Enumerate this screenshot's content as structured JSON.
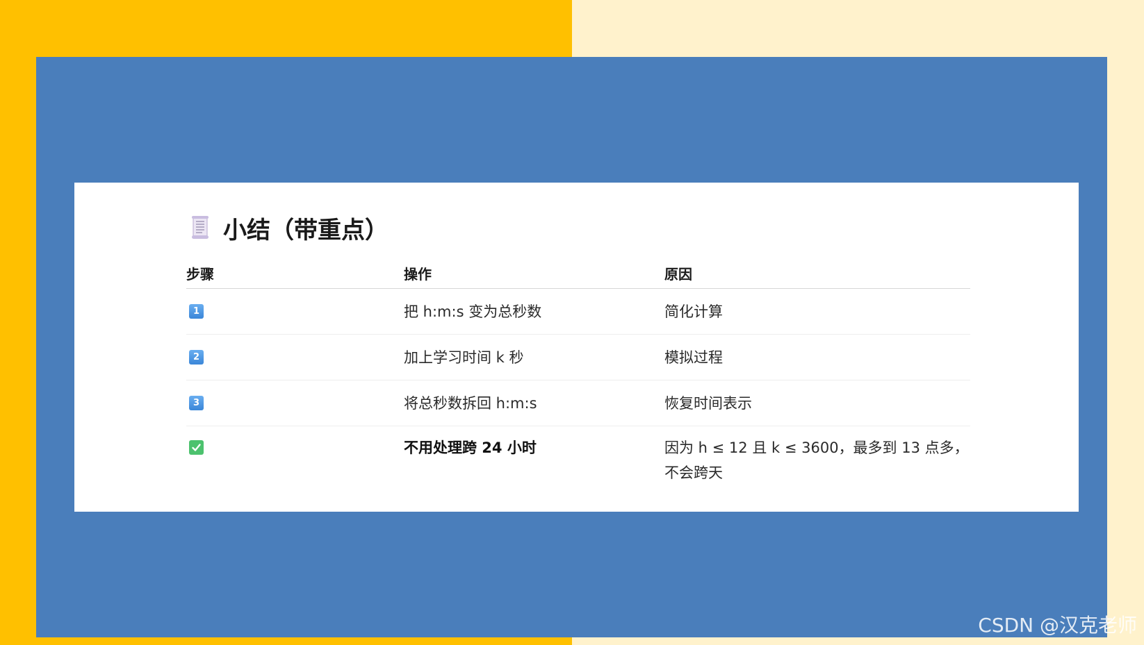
{
  "heading": {
    "icon": "scroll-icon",
    "title": "小结（带重点）"
  },
  "table": {
    "headers": [
      "步骤",
      "操作",
      "原因"
    ],
    "rows": [
      {
        "step_badge": "1",
        "step_icon": "keycap-1-icon",
        "action": "把 h:m:s 变为总秒数",
        "reason": "简化计算"
      },
      {
        "step_badge": "2",
        "step_icon": "keycap-2-icon",
        "action": "加上学习时间 k 秒",
        "reason": "模拟过程"
      },
      {
        "step_badge": "3",
        "step_icon": "keycap-3-icon",
        "action": "将总秒数拆回 h:m:s",
        "reason": "恢复时间表示"
      },
      {
        "step_icon": "check-mark-icon",
        "action": "不用处理跨 24 小时",
        "reason": "因为 h ≤ 12 且 k ≤ 3600，最多到 13 点多，不会跨天"
      }
    ]
  },
  "watermark": "CSDN @汉克老师",
  "colors": {
    "left_background": "#FFC000",
    "right_background": "#FFF2CC",
    "panel_blue": "#4A7EBB",
    "card": "#FFFFFF",
    "keycap_blue": "#3A86D8",
    "check_green": "#4CC26E"
  }
}
